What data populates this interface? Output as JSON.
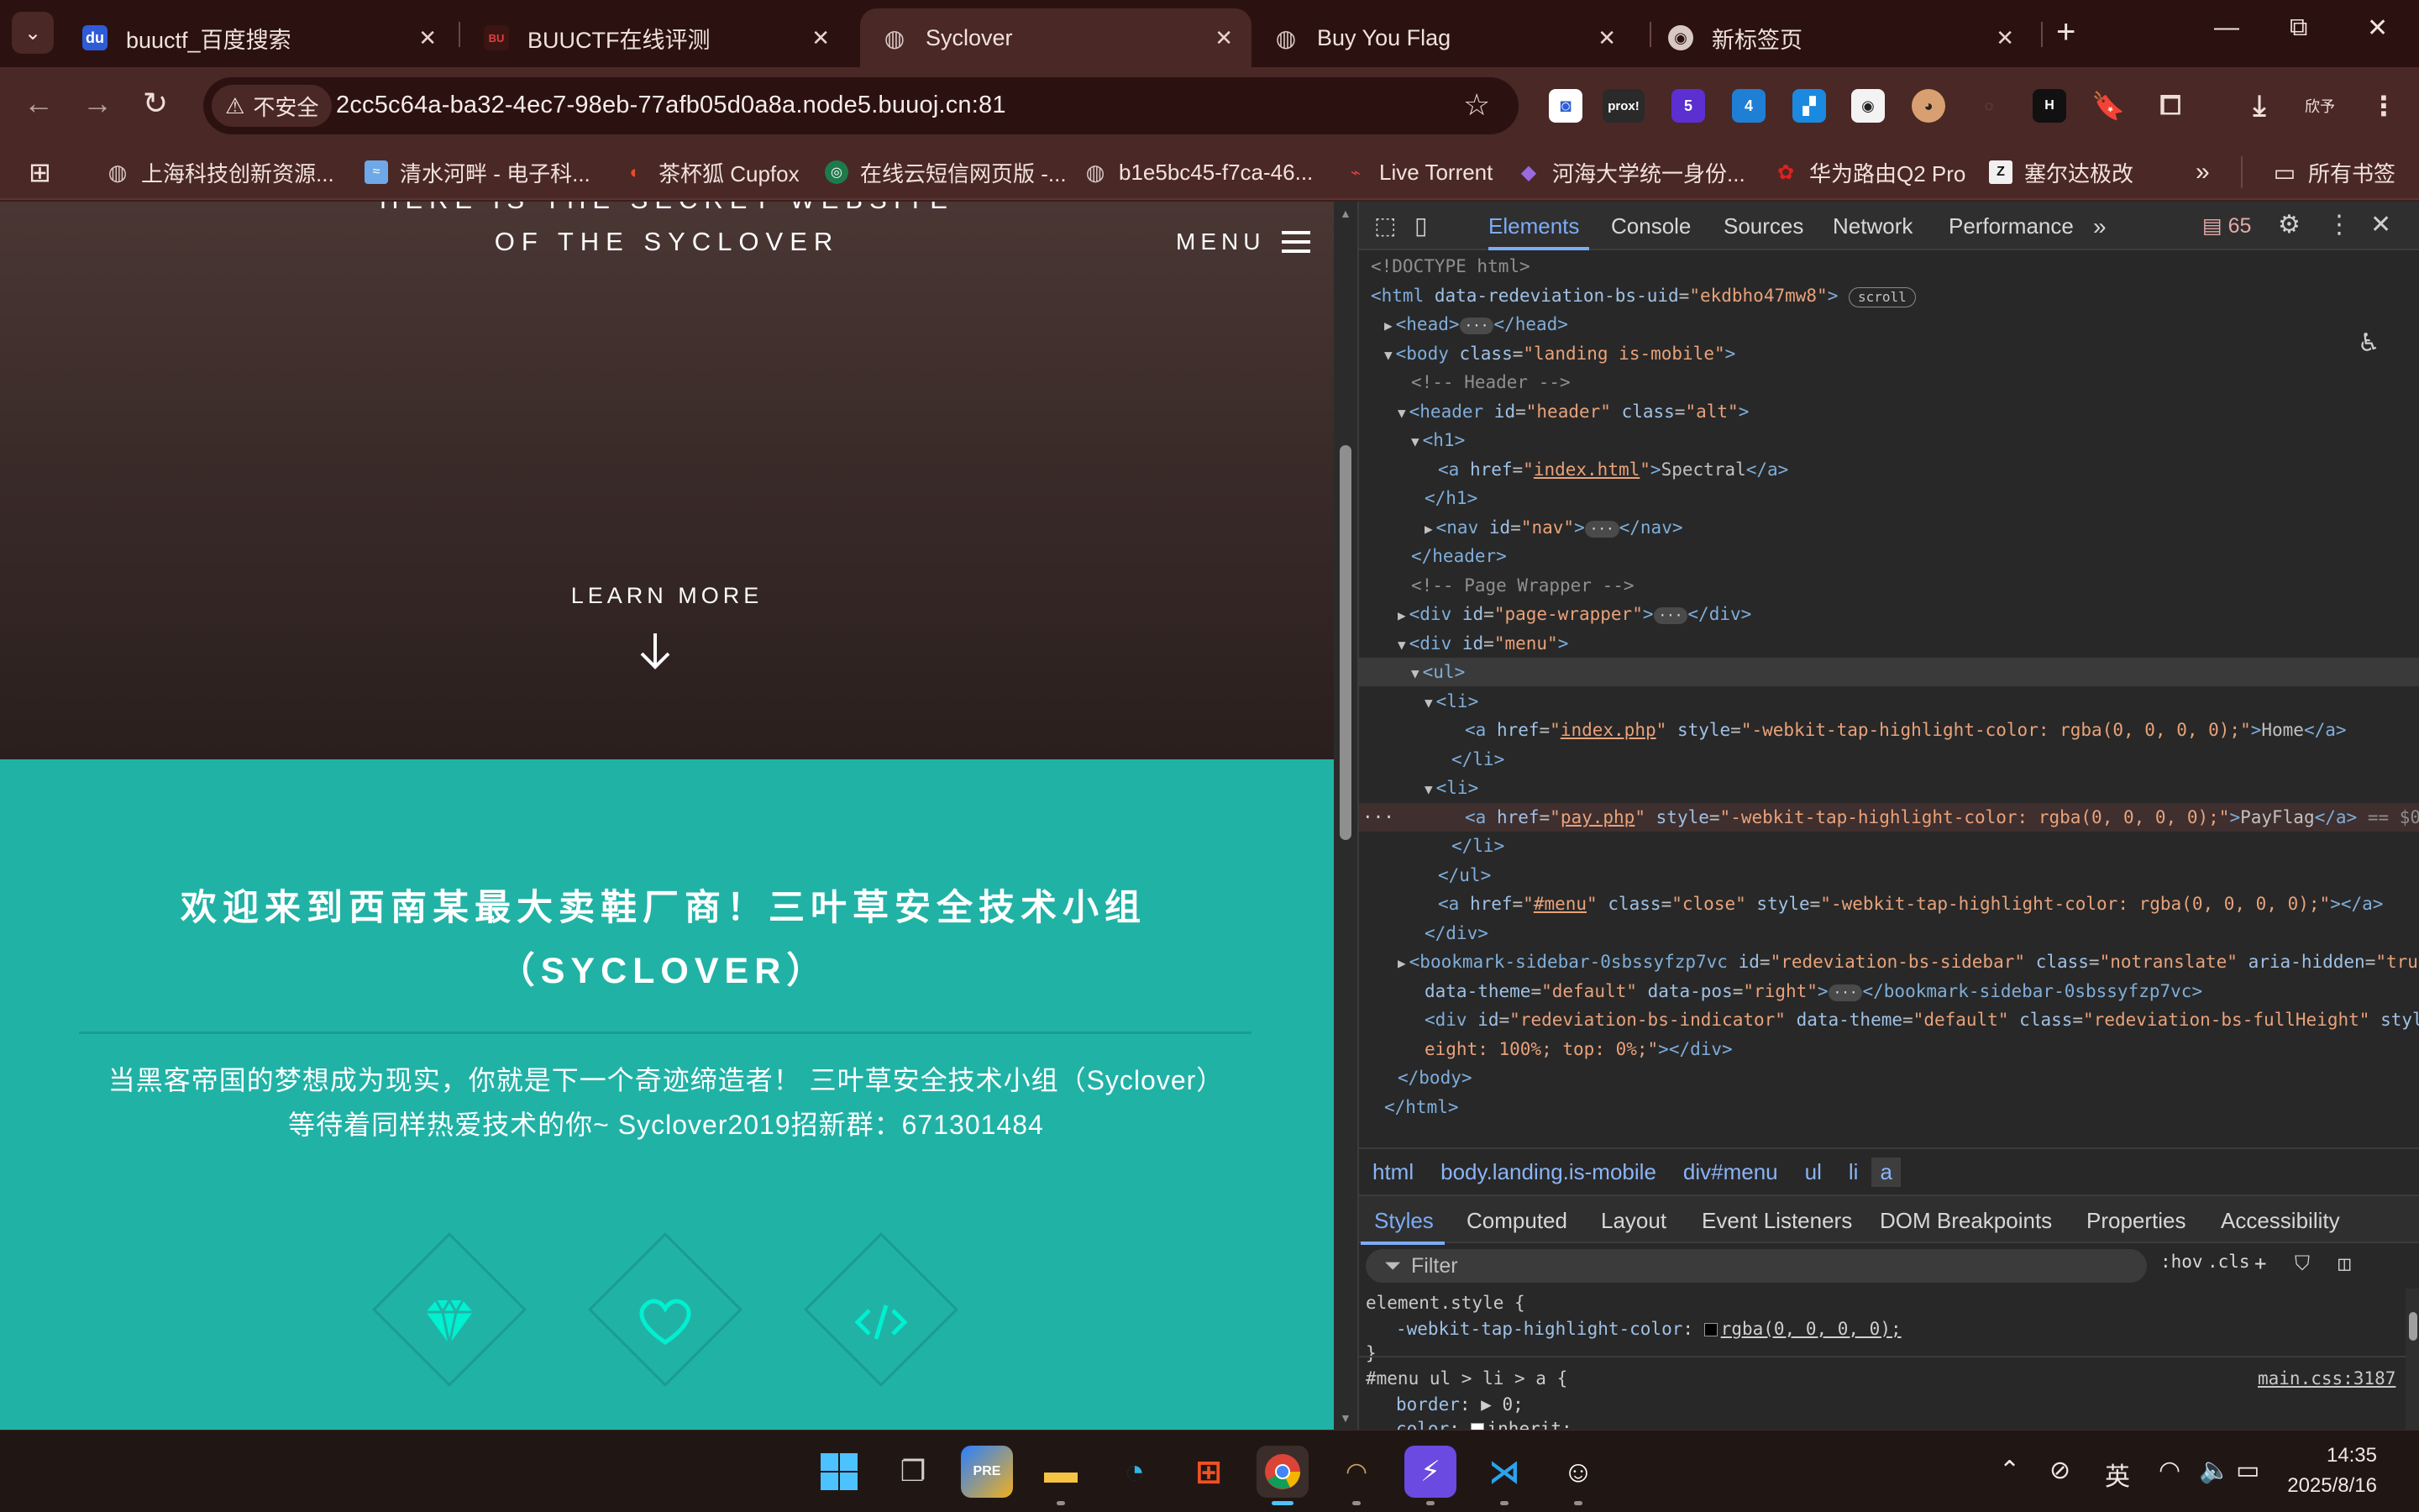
{
  "browser": {
    "tabs": [
      {
        "title": "buuctf_百度搜索",
        "favicon": "baidu-icon",
        "active": false
      },
      {
        "title": "BUUCTF在线评测",
        "favicon": "buuctf-icon",
        "active": false
      },
      {
        "title": "Syclover",
        "favicon": "globe-icon",
        "active": true
      },
      {
        "title": "Buy You Flag",
        "favicon": "globe-icon",
        "active": false
      },
      {
        "title": "新标签页",
        "favicon": "chrome-icon",
        "active": false
      }
    ],
    "security_label": "不安全",
    "url": "2cc5c64a-ba32-4ec7-98eb-77afb05d0a8a.node5.buuoj.cn:81",
    "profile_label": "欣予",
    "ext_proxy_label": "prox!",
    "ext_badge_1": "5",
    "ext_badge_2": "4",
    "bookmarks": [
      {
        "label": "上海科技创新资源...",
        "icon": "globe-icon"
      },
      {
        "label": "清水河畔 - 电子科...",
        "icon": "river-icon"
      },
      {
        "label": "茶杯狐 Cupfox",
        "icon": "fox-icon"
      },
      {
        "label": "在线云短信网页版 -...",
        "icon": "sms-icon"
      },
      {
        "label": "b1e5bc45-f7ca-46...",
        "icon": "globe-icon"
      },
      {
        "label": "Live Torrent",
        "icon": "torrent-icon"
      },
      {
        "label": "河海大学统一身份...",
        "icon": "hhu-icon"
      },
      {
        "label": "华为路由Q2 Pro",
        "icon": "huawei-icon"
      },
      {
        "label": "塞尔达极改",
        "icon": "zelda-icon"
      }
    ],
    "all_bookmarks_label": "所有书签"
  },
  "page": {
    "tagline_line1": "HERE IS THE SECRET WEBSITE",
    "tagline_line2": "OF THE SYCLOVER",
    "menu_label": "MENU",
    "learn_more": "LEARN MORE",
    "banner_title_line1": "欢迎来到西南某最大卖鞋厂商！三叶草安全技术小组",
    "banner_title_line2": "（SYCLOVER）",
    "banner_text_line1": "当黑客帝国的梦想成为现实，你就是下一个奇迹缔造者！ 三叶草安全技术小组（Syclover）",
    "banner_text_line2": "等待着同样热爱技术的你~ Syclover2019招新群：671301484",
    "accent_color": "#21b2a6",
    "icon_color": "#00f0d0"
  },
  "devtools": {
    "tabs": [
      "Elements",
      "Console",
      "Sources",
      "Network",
      "Performance"
    ],
    "more_tabs": "»",
    "issues_count": "65",
    "dom": {
      "doctype": "<!DOCTYPE html>",
      "html_attr_val": "ekdbho47mw8",
      "scroll_badge": "scroll",
      "body_class": "landing is-mobile",
      "comment_header": "<!-- Header -->",
      "header_id": "header",
      "header_class": "alt",
      "h1_href": "index.html",
      "h1_text": "Spectral",
      "nav_id": "nav",
      "comment_wrapper": "<!-- Page Wrapper -->",
      "wrapper_id": "page-wrapper",
      "menu_id": "menu",
      "li1_href": "index.php",
      "li1_style": "-webkit-tap-highlight-color: rgba(0, 0, 0, 0);",
      "li1_text": "Home",
      "li2_href": "pay.php",
      "li2_style": "-webkit-tap-highlight-color: rgba(0, 0, 0, 0);",
      "li2_text": "PayFlag",
      "selected_marker": "== $0",
      "close_href": "#menu",
      "close_class": "close",
      "close_style": "-webkit-tap-highlight-color: rgba(0, 0, 0, 0);",
      "bm_tag": "bookmark-sidebar-0sbssyfzp7vc",
      "bm_id": "redeviation-bs-sidebar",
      "bm_class": "notranslate",
      "bm_aria": "true",
      "bm_theme": "default",
      "bm_pos": "right",
      "ind_id": "redeviation-bs-indicator",
      "ind_theme": "default",
      "ind_class": "redeviation-bs-fullHeight",
      "ind_style_1": "h",
      "ind_style_2": "eight: 100%; top: 0%;"
    },
    "breadcrumb": [
      "html",
      "body.landing.is-mobile",
      "div#menu",
      "ul",
      "li",
      "a"
    ],
    "style_tabs": [
      "Styles",
      "Computed",
      "Layout",
      "Event Listeners",
      "DOM Breakpoints",
      "Properties",
      "Accessibility"
    ],
    "filter_placeholder": "Filter",
    "hov_label": ":hov",
    "cls_label": ".cls",
    "styles": {
      "element_style": "element.style {",
      "prop1": "-webkit-tap-highlight-color",
      "val1": "rgba(0, 0, 0, 0);",
      "close_brace": "}",
      "rule_selector": "#menu ul > li > a {",
      "rule_source": "main.css:3187",
      "prop2": "border",
      "val2": "0;",
      "prop3": "color",
      "val3": "inherit;"
    }
  },
  "taskbar": {
    "time": "14:35",
    "date": "2025/8/16",
    "ime_label": "英"
  }
}
